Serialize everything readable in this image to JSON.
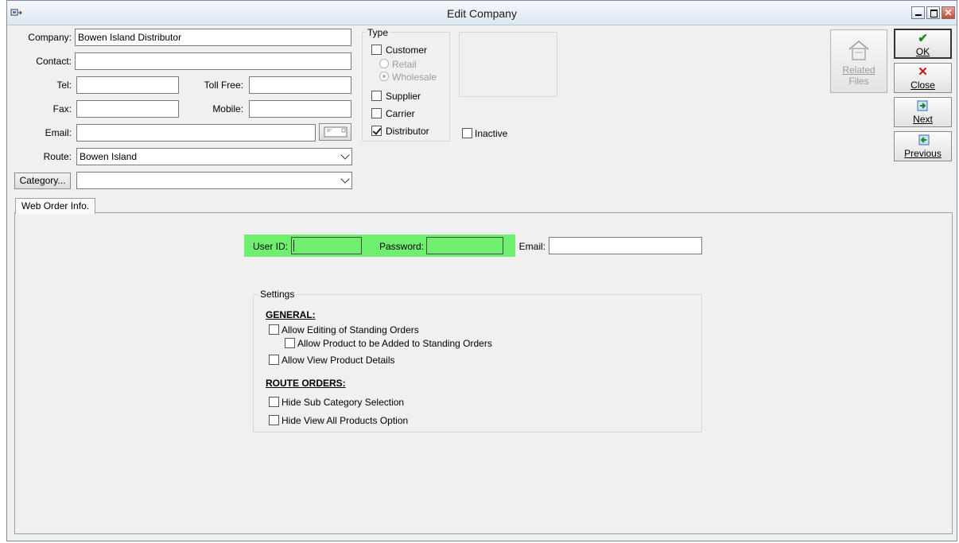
{
  "window": {
    "title": "Edit Company"
  },
  "form": {
    "company_label": "Company:",
    "company_value": "Bowen Island Distributor",
    "contact_label": "Contact:",
    "contact_value": "",
    "tel_label": "Tel:",
    "tel_value": "",
    "tollfree_label": "Toll Free:",
    "tollfree_value": "",
    "fax_label": "Fax:",
    "fax_value": "",
    "mobile_label": "Mobile:",
    "mobile_value": "",
    "email_label": "Email:",
    "email_value": "",
    "route_label": "Route:",
    "route_value": "Bowen Island",
    "category_button": "Category...",
    "category_value": ""
  },
  "type_group": {
    "title": "Type",
    "customer": {
      "label": "Customer",
      "checked": false
    },
    "retail": {
      "label": "Retail",
      "selected": false
    },
    "wholesale": {
      "label": "Wholesale",
      "selected": true
    },
    "supplier": {
      "label": "Supplier",
      "checked": false
    },
    "carrier": {
      "label": "Carrier",
      "checked": false
    },
    "distributor": {
      "label": "Distributor",
      "checked": true
    }
  },
  "inactive": {
    "label": "Inactive",
    "checked": false
  },
  "side_buttons": {
    "related_files_line1": "Related",
    "related_files_line2": "Files",
    "ok": "OK",
    "close": "Close",
    "next": "Next",
    "previous": "Previous"
  },
  "tabs": [
    {
      "label": "Web Order Info."
    }
  ],
  "web_order": {
    "user_id_label": "User ID:",
    "user_id_value": "",
    "password_label": "Password:",
    "password_value": "",
    "email_label": "Email:",
    "email_value": ""
  },
  "settings": {
    "title": "Settings",
    "general_header": "GENERAL:",
    "allow_editing_standing": "Allow Editing of Standing Orders",
    "allow_product_added": "Allow Product to be Added to Standing Orders",
    "allow_view_details": "Allow View Product Details",
    "route_orders_header": "ROUTE ORDERS:",
    "hide_sub_category": "Hide Sub Category Selection",
    "hide_view_all": "Hide View All Products Option"
  },
  "colors": {
    "highlight": "#6ef06e",
    "ok_check": "#1a8a1a",
    "close_x": "#cc1111"
  }
}
